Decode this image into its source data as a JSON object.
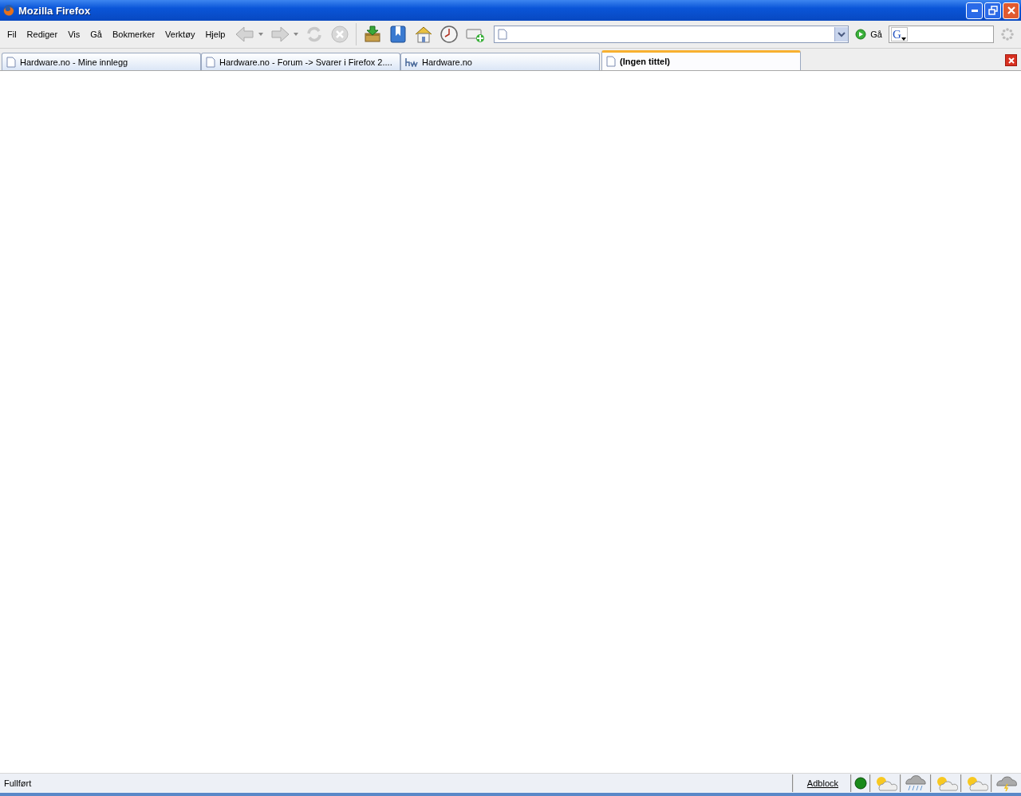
{
  "window": {
    "title": "Mozilla Firefox"
  },
  "menu": [
    "Fil",
    "Rediger",
    "Vis",
    "Gå",
    "Bokmerker",
    "Verktøy",
    "Hjelp"
  ],
  "nav_buttons": [
    {
      "kind": "back",
      "disabled": true
    },
    {
      "kind": "forward",
      "disabled": true
    },
    {
      "kind": "reload",
      "disabled": true
    },
    {
      "kind": "stop",
      "disabled": true
    }
  ],
  "tool_buttons": [
    {
      "kind": "download"
    },
    {
      "kind": "bookmarks"
    },
    {
      "kind": "home"
    },
    {
      "kind": "history"
    },
    {
      "kind": "add"
    }
  ],
  "go_button": {
    "label": "Gå"
  },
  "search": {
    "engine_label": "G"
  },
  "tabs": [
    {
      "label": "Hardware.no - Mine innlegg",
      "selected": false
    },
    {
      "label": "Hardware.no - Forum -> Svarer i Firefox 2....",
      "selected": false
    },
    {
      "label": "Hardware.no",
      "selected": false
    },
    {
      "label": "(Ingen tittel)",
      "selected": true
    }
  ],
  "status_bar": {
    "text": "Fullført",
    "adblock": "Adblock",
    "weather": [
      {
        "kind": "partly-cloudy"
      },
      {
        "kind": "rain"
      },
      {
        "kind": "partly-cloudy"
      },
      {
        "kind": "partly-cloudy"
      },
      {
        "kind": "storm"
      }
    ]
  }
}
